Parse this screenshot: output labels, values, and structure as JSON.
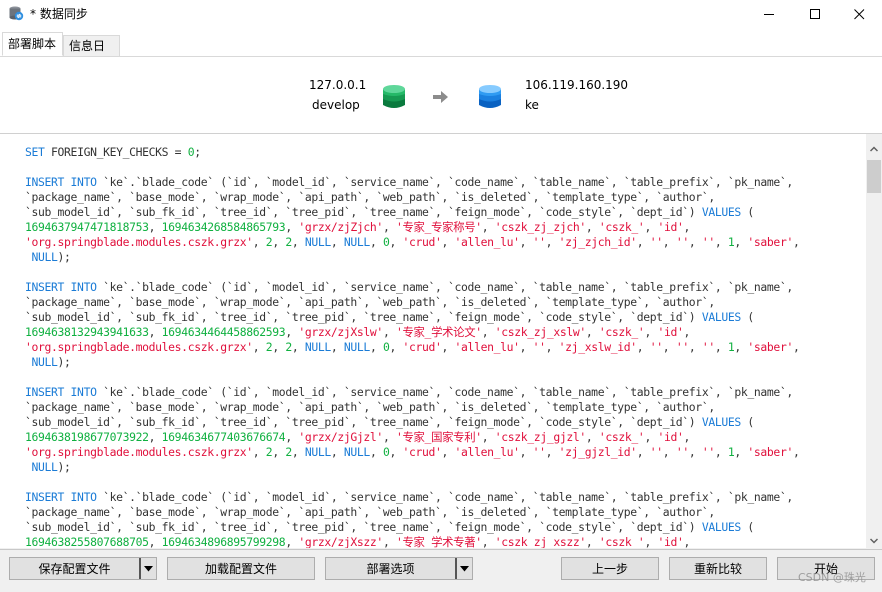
{
  "window": {
    "title": "* 数据同步",
    "icon": "database-sync-icon",
    "controls": {
      "minimize": "—",
      "maximize": "☐",
      "close": "✕"
    }
  },
  "tabs": [
    {
      "label": "部署脚本",
      "active": true
    },
    {
      "label": "信息日志",
      "active": false
    }
  ],
  "connection": {
    "source": {
      "host": "127.0.0.1",
      "database": "develop",
      "icon": "database-green-icon",
      "color": "#1fae5b"
    },
    "target": {
      "host": "106.119.160.190",
      "database": "ke",
      "icon": "database-blue-icon",
      "color": "#1e88e5"
    },
    "arrow": "arrow-right-icon"
  },
  "script": {
    "colors": {
      "keyword": "#1a7bd6",
      "number": "#10b040",
      "string": "#e0103c",
      "plain": "#333333"
    },
    "set_stmt": {
      "kw": "SET",
      "text": " FOREIGN_KEY_CHECKS = ",
      "num": "0",
      "end": ";"
    },
    "column_lines": [
      "`ke`.`blade_code` (`id`, `model_id`, `service_name`, `code_name`, `table_name`, `table_prefix`, `pk_name`,",
      "`package_name`, `base_mode`, `wrap_mode`, `api_path`, `web_path`, `is_deleted`, `template_type`, `author`,",
      "`sub_model_id`, `sub_fk_id`, `tree_id`, `tree_pid`, `tree_name`, `feign_mode`, `code_style`, `dept_id`)"
    ],
    "insert_kw": "INSERT INTO",
    "values_kw": "VALUES",
    "inserts": [
      {
        "id": "1694637947471818753",
        "model_id": "1694634268584865793",
        "service_name": "'grzx/zjZjch'",
        "code_name": "'专家_专家称号'",
        "table_name": "'cszk_zj_zjch'",
        "table_prefix": "'cszk_'",
        "pk_name": "'id'",
        "package_name": "'org.springblade.modules.cszk.grzx'",
        "base_mode": "2",
        "wrap_mode": "2",
        "api_path": "NULL",
        "web_path": "NULL",
        "is_deleted": "0",
        "template_type": "'crud'",
        "author": "'allen_lu'",
        "sub_model_id": "''",
        "sub_fk_id": "'zj_zjch_id'",
        "tree_id": "''",
        "tree_pid": "''",
        "tree_name": "''",
        "feign_mode": "1",
        "code_style": "'saber'",
        "dept_id": "NULL"
      },
      {
        "id": "1694638132943941633",
        "model_id": "1694634464458862593",
        "service_name": "'grzx/zjXslw'",
        "code_name": "'专家_学术论文'",
        "table_name": "'cszk_zj_xslw'",
        "table_prefix": "'cszk_'",
        "pk_name": "'id'",
        "package_name": "'org.springblade.modules.cszk.grzx'",
        "base_mode": "2",
        "wrap_mode": "2",
        "api_path": "NULL",
        "web_path": "NULL",
        "is_deleted": "0",
        "template_type": "'crud'",
        "author": "'allen_lu'",
        "sub_model_id": "''",
        "sub_fk_id": "'zj_xslw_id'",
        "tree_id": "''",
        "tree_pid": "''",
        "tree_name": "''",
        "feign_mode": "1",
        "code_style": "'saber'",
        "dept_id": "NULL"
      },
      {
        "id": "1694638198677073922",
        "model_id": "1694634677403676674",
        "service_name": "'grzx/zjGjzl'",
        "code_name": "'专家_国家专利'",
        "table_name": "'cszk_zj_gjzl'",
        "table_prefix": "'cszk_'",
        "pk_name": "'id'",
        "package_name": "'org.springblade.modules.cszk.grzx'",
        "base_mode": "2",
        "wrap_mode": "2",
        "api_path": "NULL",
        "web_path": "NULL",
        "is_deleted": "0",
        "template_type": "'crud'",
        "author": "'allen_lu'",
        "sub_model_id": "''",
        "sub_fk_id": "'zj_gjzl_id'",
        "tree_id": "''",
        "tree_pid": "''",
        "tree_name": "''",
        "feign_mode": "1",
        "code_style": "'saber'",
        "dept_id": "NULL"
      },
      {
        "id": "1694638255807688705",
        "model_id": "1694634896895799298",
        "service_name": "'grzx/zjXszz'",
        "code_name": "'专家_学术专著'",
        "table_name": "'cszk_zj_xszz'",
        "table_prefix": "'cszk_'",
        "pk_name": "'id'",
        "partial": true
      }
    ]
  },
  "scrollbar": {
    "up": "chevron-up-icon",
    "down": "chevron-down-icon",
    "position": 0.0
  },
  "footer": {
    "save_config": "保存配置文件",
    "load_config": "加载配置文件",
    "deploy_options": "部署选项",
    "previous": "上一步",
    "recompare": "重新比较",
    "start": "开始"
  },
  "watermark": "CSDN @珠光"
}
